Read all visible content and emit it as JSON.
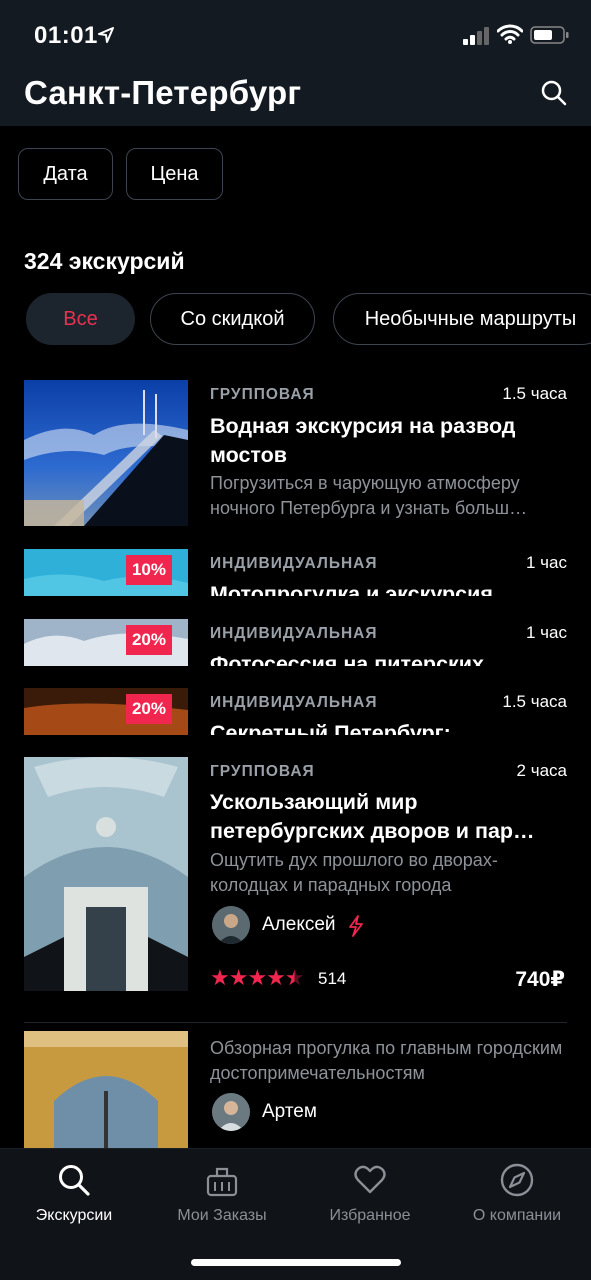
{
  "status_bar": {
    "time": "01:01"
  },
  "header": {
    "title": "Санкт-Петербург"
  },
  "filters": {
    "date_label": "Дата",
    "price_label": "Цена"
  },
  "results": {
    "count_label": "324 экскурсий"
  },
  "chips": [
    "Все",
    "Со скидкой",
    "Необычные маршруты"
  ],
  "tours": [
    {
      "type": "ГРУППОВАЯ",
      "duration": "1.5 часа",
      "title": "Водная экскурсия на развод мостов",
      "description": "Погрузиться в чарующую атмосферу ночного Петербурга и узнать больш…"
    },
    {
      "type": "ИНДИВИДУАЛЬНАЯ",
      "duration": "1 час",
      "title": "Мотопрогулка и экскурсия",
      "discount": "10%"
    },
    {
      "type": "ИНДИВИДУАЛЬНАЯ",
      "duration": "1 час",
      "title": "Фотосессия на питерских",
      "discount": "20%"
    },
    {
      "type": "ИНДИВИДУАЛЬНАЯ",
      "duration": "1.5 часа",
      "title": "Секретный Петербург:",
      "discount": "20%"
    },
    {
      "type": "ГРУППОВАЯ",
      "duration": "2 часа",
      "title_line1": "Ускользающий мир",
      "title_line2": "петербургских дворов и пар…",
      "description": "Ощутить дух прошлого во дворах-колодцах и парадных города",
      "guide": "Алексей",
      "rating_stars": "★★★★★",
      "rating_value": 4.5,
      "reviews": "514",
      "price": "740₽"
    },
    {
      "description": "Обзорная прогулка по главным городским достопримечательностям",
      "guide": "Артем"
    }
  ],
  "tabs": [
    {
      "label": "Экскурсии",
      "icon": "search-icon"
    },
    {
      "label": "Мои Заказы",
      "icon": "orders-icon"
    },
    {
      "label": "Избранное",
      "icon": "heart-icon"
    },
    {
      "label": "О компании",
      "icon": "compass-icon"
    }
  ],
  "colors": {
    "accent": "#f0264e",
    "header_bg": "#141a22",
    "background": "#000000"
  }
}
